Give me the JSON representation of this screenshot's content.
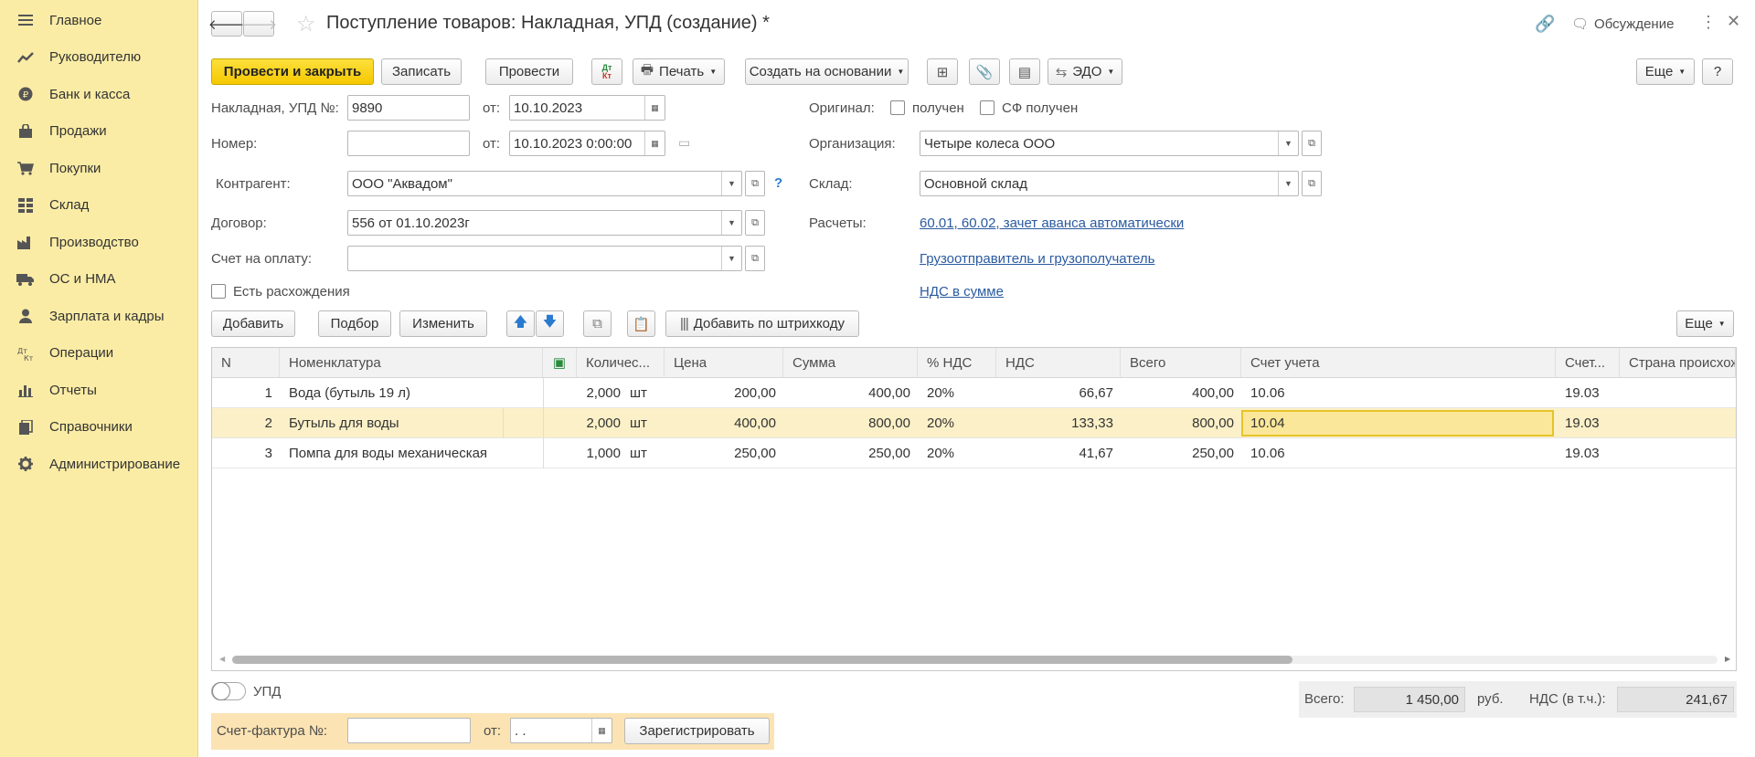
{
  "sidebar": {
    "items": [
      {
        "label": "Главное",
        "icon": "menu-lines-icon"
      },
      {
        "label": "Руководителю",
        "icon": "trend-chart-icon"
      },
      {
        "label": "Банк и касса",
        "icon": "ruble-coin-icon"
      },
      {
        "label": "Продажи",
        "icon": "shopping-bag-icon"
      },
      {
        "label": "Покупки",
        "icon": "shopping-cart-icon"
      },
      {
        "label": "Склад",
        "icon": "warehouse-grid-icon"
      },
      {
        "label": "Производство",
        "icon": "factory-icon"
      },
      {
        "label": "ОС и НМА",
        "icon": "truck-icon"
      },
      {
        "label": "Зарплата и кадры",
        "icon": "person-icon"
      },
      {
        "label": "Операции",
        "icon": "dt-kt-icon"
      },
      {
        "label": "Отчеты",
        "icon": "bar-chart-icon"
      },
      {
        "label": "Справочники",
        "icon": "books-icon"
      },
      {
        "label": "Администрирование",
        "icon": "gear-icon"
      }
    ]
  },
  "header": {
    "title": "Поступление товаров: Накладная, УПД (создание) *",
    "discussion": "Обсуждение"
  },
  "toolbar": {
    "post_close": "Провести и закрыть",
    "save": "Записать",
    "post": "Провести",
    "dtkt": "Дт Кт",
    "print": "Печать",
    "create_based": "Создать на основании",
    "edo": "ЭДО",
    "more": "Еще",
    "help": "?"
  },
  "form": {
    "invoice_no_label": "Накладная, УПД №:",
    "invoice_no": "9890",
    "from_label": "от:",
    "invoice_date": "10.10.2023",
    "number_label": "Номер:",
    "number": "",
    "number_date": "10.10.2023  0:00:00",
    "original_label": "Оригинал:",
    "received_label": "получен",
    "sf_received_label": "СФ получен",
    "org_label": "Организация:",
    "org": "Четыре колеса ООО",
    "counterparty_label": "Контрагент:",
    "counterparty": "ООО \"Аквадом\"",
    "warehouse_label": "Склад:",
    "warehouse": "Основной склад",
    "contract_label": "Договор:",
    "contract": "556 от 01.10.2023г",
    "payments_label": "Расчеты:",
    "payments_link": "60.01, 60.02, зачет аванса автоматически",
    "bill_label": "Счет на оплату:",
    "bill": "",
    "shipper_link": "Грузоотправитель и грузополучатель",
    "vat_link": "НДС в сумме",
    "discrepancy_label": "Есть расхождения"
  },
  "table_toolbar": {
    "add": "Добавить",
    "pick": "Подбор",
    "change": "Изменить",
    "barcode": "Добавить по штрихкоду",
    "more": "Еще"
  },
  "table": {
    "columns": [
      "N",
      "Номенклатура",
      "Количес...",
      "Цена",
      "Сумма",
      "% НДС",
      "НДС",
      "Всего",
      "Счет учета",
      "Счет...",
      "Страна происхож"
    ],
    "rows": [
      {
        "n": "1",
        "name": "Вода (бутыль 19 л)",
        "qty": "2,000",
        "unit": "шт",
        "price": "200,00",
        "sum": "400,00",
        "vat_rate": "20%",
        "vat": "66,67",
        "total": "400,00",
        "account": "10.06",
        "vat_account": "19.03"
      },
      {
        "n": "2",
        "name": "Бутыль для воды",
        "qty": "2,000",
        "unit": "шт",
        "price": "400,00",
        "sum": "800,00",
        "vat_rate": "20%",
        "vat": "133,33",
        "total": "800,00",
        "account": "10.04",
        "vat_account": "19.03"
      },
      {
        "n": "3",
        "name": "Помпа для воды механическая",
        "qty": "1,000",
        "unit": "шт",
        "price": "250,00",
        "sum": "250,00",
        "vat_rate": "20%",
        "vat": "41,67",
        "total": "250,00",
        "account": "10.06",
        "vat_account": "19.03"
      }
    ]
  },
  "footer": {
    "upd_label": "УПД",
    "total_label": "Всего:",
    "total": "1 450,00",
    "currency": "руб.",
    "vat_label": "НДС (в т.ч.):",
    "vat_total": "241,67",
    "sf_label": "Счет-фактура №:",
    "sf_number": "",
    "sf_from_label": "от:",
    "sf_date": " .  .",
    "register": "Зарегистрировать"
  },
  "colors": {
    "sidebar_bg": "#fbeca5",
    "primary_button": "#f5c800",
    "link": "#2a5aa0",
    "selected_row": "#fbf0c7"
  }
}
